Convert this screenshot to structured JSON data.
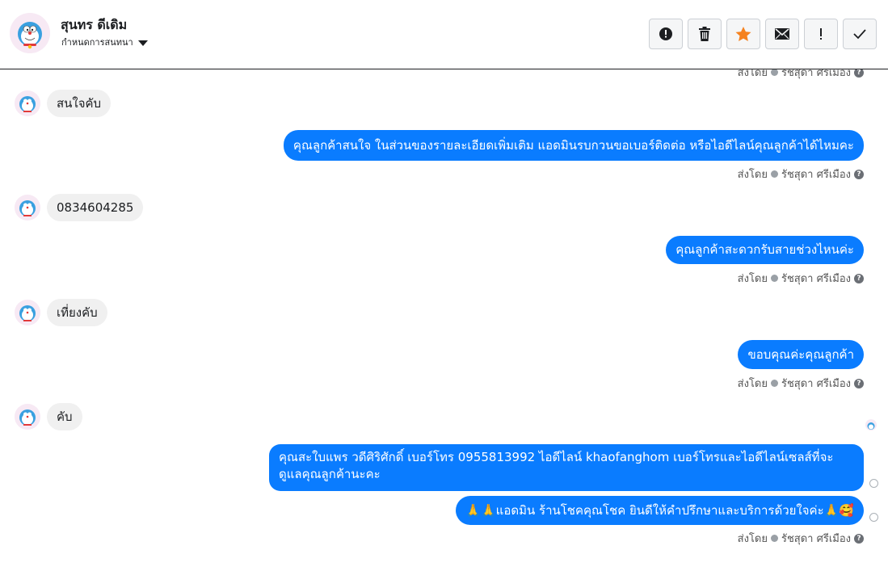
{
  "header": {
    "contact_name": "สุนทร ดีเดิม",
    "assign_label": "กำหนดการสนทนา",
    "buttons": [
      {
        "icon": "alert-circle-icon"
      },
      {
        "icon": "trash-icon"
      },
      {
        "icon": "star-icon",
        "color": "#f5821f"
      },
      {
        "icon": "envelope-icon"
      },
      {
        "icon": "exclamation-icon"
      },
      {
        "icon": "check-icon"
      }
    ]
  },
  "messages": [
    {
      "side": "in",
      "text": "สนใจคับ"
    },
    {
      "side": "out",
      "text": "คุณลูกค้าสนใจ ในส่วนของรายละเอียดเพิ่มเติม แอดมินรบกวนขอเบอร์ติดต่อ หรือไอดีไลน์คุณลูกค้าได้ไหมคะ"
    },
    {
      "side": "in",
      "text": "0834604285"
    },
    {
      "side": "out",
      "text": "คุณลูกค้าสะดวกรับสายช่วงไหนค่ะ"
    },
    {
      "side": "in",
      "text": "เที่ยงคับ"
    },
    {
      "side": "out",
      "text": "ขอบคุณค่ะคุณลูกค้า"
    },
    {
      "side": "in",
      "text": "คับ"
    },
    {
      "side": "out",
      "text": "คุณสะใบแพร วดีศิริศักดิ์ เบอร์โทร 0955813992  ไอดีไลน์  khaofanghom   เบอร์โทรและไอดีไลน์เซลส์ที่จะดูแลคุณลูกค้านะคะ"
    },
    {
      "side": "out",
      "text": "🙏🙏แอดมิน ร้านโชคคุณโชค ยินดีให้คำปรึกษาและบริการด้วยใจค่ะ🙏🥰"
    }
  ],
  "sent_by": {
    "prefix": "ส่งโดย",
    "agent": "รัชสุดา ศรีเมือง",
    "help": "?"
  },
  "colors": {
    "outgoing_bubble": "#0a7cff",
    "incoming_bubble": "#f0f0f0",
    "star": "#f5821f"
  }
}
